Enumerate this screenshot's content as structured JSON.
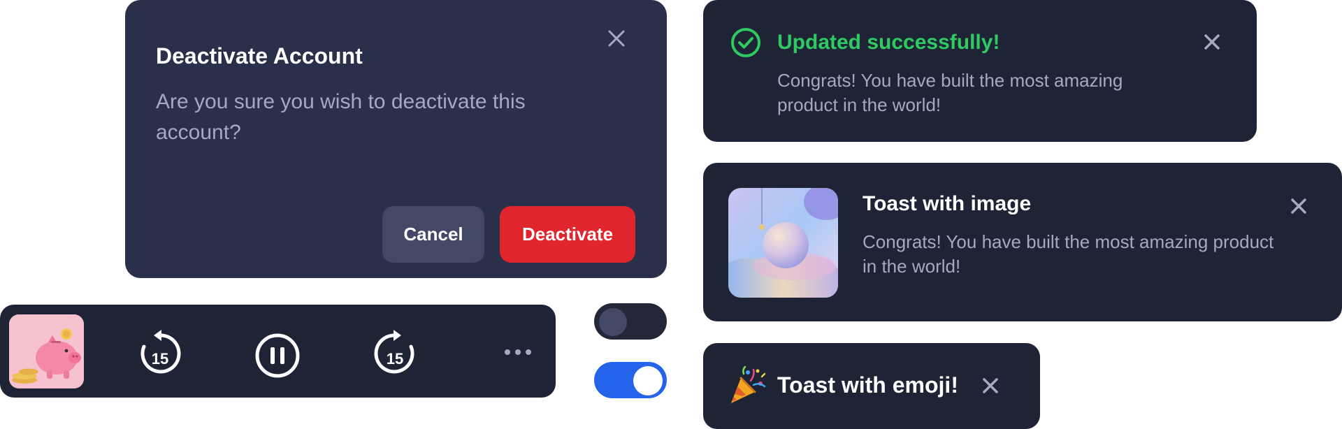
{
  "modal": {
    "title": "Deactivate Account",
    "body": "Are you sure you wish to deactivate this account?",
    "cancel_label": "Cancel",
    "deactivate_label": "Deactivate",
    "close_icon": "close-icon"
  },
  "toast_success": {
    "title": "Updated successfully!",
    "body": "Congrats! You have built the most amazing product in the world!",
    "icon": "check-circle-icon",
    "color": "#2fcb62"
  },
  "toast_image": {
    "title": "Toast with image",
    "body": "Congrats! You have built the most amazing product in the world!",
    "icon": "abstract-sphere-image"
  },
  "toast_emoji": {
    "title": "Toast with emoji!",
    "icon": "party-popper-icon"
  },
  "player": {
    "rewind_seconds": "15",
    "forward_seconds": "15",
    "artwork": "piggy-bank-image",
    "state": "playing"
  },
  "toggles": {
    "first": {
      "checked": false
    },
    "second": {
      "checked": true,
      "color": "#2563eb"
    }
  },
  "colors": {
    "danger": "#e0262c",
    "panel": "#1f2336",
    "modal": "#2a2f4a"
  }
}
